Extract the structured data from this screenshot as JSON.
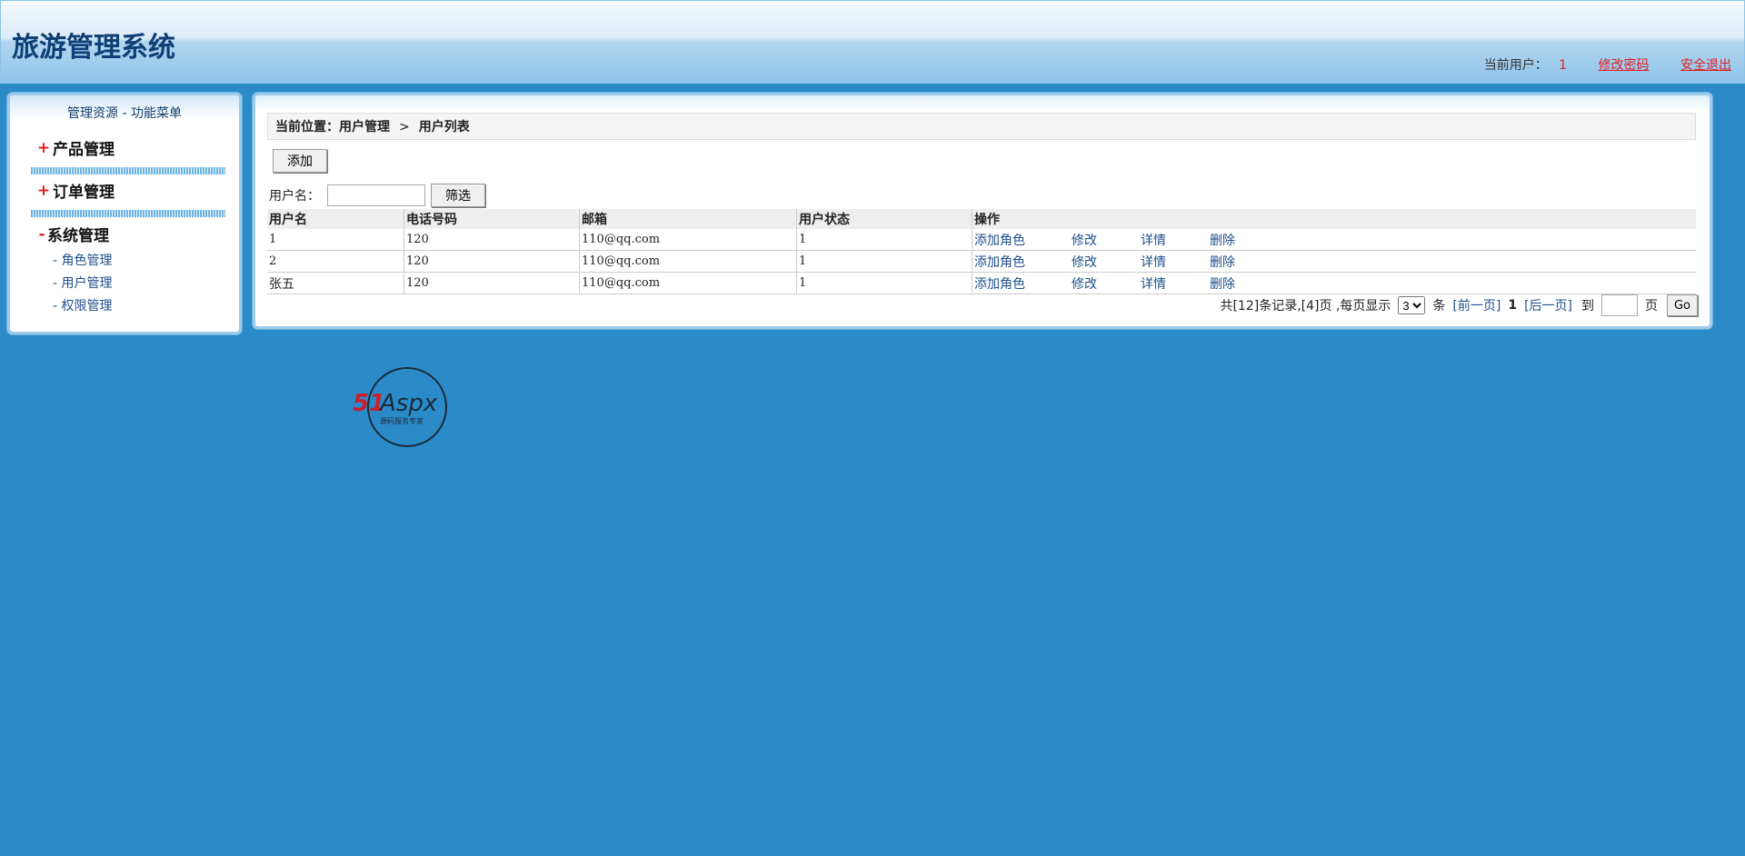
{
  "header": {
    "title": "旅游管理系统",
    "current_user_label": "当前用户：",
    "current_user": "1",
    "change_password": "修改密码",
    "logout": "安全退出"
  },
  "sidebar": {
    "title": "管理资源 - 功能菜单",
    "groups": [
      {
        "sign": "+",
        "label": "产品管理"
      },
      {
        "sign": "+",
        "label": "订单管理"
      },
      {
        "sign": "-",
        "label": "系统管理",
        "items": [
          "- 角色管理",
          "- 用户管理",
          "- 权限管理"
        ]
      }
    ]
  },
  "main": {
    "breadcrumb": {
      "prefix": "当前位置：",
      "section": "用户管理",
      "sep": ">",
      "page": "用户列表"
    },
    "add_button": "添加",
    "filter": {
      "label": "用户名：",
      "value": "",
      "button": "筛选"
    },
    "table": {
      "headers": [
        "用户名",
        "电话号码",
        "邮箱",
        "用户状态",
        "操作"
      ],
      "rows": [
        {
          "username": "1",
          "phone": "120",
          "email": "110@qq.com",
          "status": "1"
        },
        {
          "username": "2",
          "phone": "120",
          "email": "110@qq.com",
          "status": "1"
        },
        {
          "username": "张五",
          "phone": "120",
          "email": "110@qq.com",
          "status": "1"
        }
      ],
      "actions": [
        "添加角色",
        "修改",
        "详情",
        "删除"
      ]
    },
    "pager": {
      "summary": "共[12]条记录,[4]页 ,每页显示",
      "page_size": "3",
      "unit": "条",
      "prev": "[前一页]",
      "current": "1",
      "next": "[后一页]",
      "goto_label": "到",
      "page_label": "页",
      "go": "Go"
    }
  },
  "logo": {
    "text": "51Aspx",
    "tagline": "源码服务专家"
  },
  "colors": {
    "background": "#2b8bc8",
    "title": "#0f3f74",
    "link_red": "#e02020",
    "link_blue": "#1f4f8c"
  }
}
